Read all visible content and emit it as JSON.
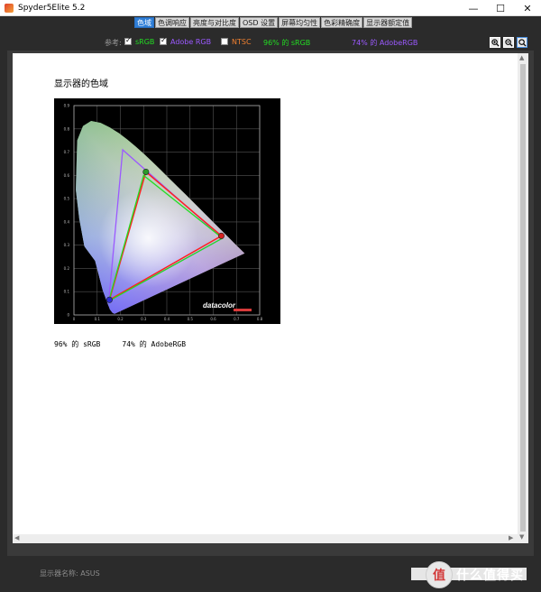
{
  "window": {
    "title": "Spyder5Elite 5.2",
    "minimize": "—",
    "maximize": "☐",
    "close": "✕"
  },
  "tabs": [
    {
      "label": "色域",
      "active": true
    },
    {
      "label": "色调响应"
    },
    {
      "label": "亮度与对比度"
    },
    {
      "label": "OSD 设置"
    },
    {
      "label": "屏幕均匀性"
    },
    {
      "label": "色彩精确度"
    },
    {
      "label": "显示器额定值"
    }
  ],
  "options": {
    "reference_label": "参考:",
    "srgb_label": "sRGB",
    "adobergb_label": "Adobe RGB",
    "ntsc_label": "NTSC",
    "srgb_coverage": "96% 的 sRGB",
    "adobergb_coverage": "74% 的 AdobeRGB",
    "srgb_checked": true,
    "adobergb_checked": true,
    "ntsc_checked": false,
    "zoom_icons": [
      "zoom-in-icon",
      "zoom-out-icon",
      "zoom-fit-icon"
    ]
  },
  "report": {
    "title": "显示器的色域",
    "result_line": "96% 的 sRGB     74% 的 AdobeRGB",
    "diagram": {
      "x_ticks": [
        "0",
        "0.1",
        "0.2",
        "0.3",
        "0.4",
        "0.5",
        "0.6",
        "0.7",
        "0.8"
      ],
      "y_ticks": [
        "0.9",
        "0.8",
        "0.7",
        "0.6",
        "0.5",
        "0.4",
        "0.3",
        "0.2",
        "0.1",
        "0"
      ],
      "logo": "datacolor",
      "srgb": [
        [
          0.64,
          0.33
        ],
        [
          0.3,
          0.6
        ],
        [
          0.15,
          0.06
        ]
      ],
      "adobergb": [
        [
          0.64,
          0.33
        ],
        [
          0.21,
          0.71
        ],
        [
          0.15,
          0.06
        ]
      ],
      "monitor": [
        [
          0.635,
          0.34
        ],
        [
          0.31,
          0.615
        ],
        [
          0.153,
          0.065
        ]
      ]
    }
  },
  "footer": {
    "display_name": "显示器名称: ASUS",
    "watermark_symbol": "值",
    "watermark_text": "什么值得买"
  },
  "colors": {
    "srgb": "#22dd22",
    "adobergb": "#9b59ff",
    "ntsc": "#f08030",
    "monitor": "#ff2020",
    "tab_active": "#2f7fd8"
  }
}
